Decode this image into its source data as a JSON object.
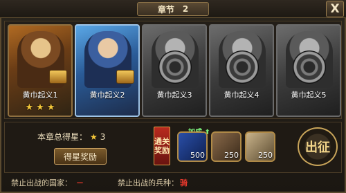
{
  "header": {
    "chapter_label": "章节",
    "chapter_number": "2",
    "close_label": "X"
  },
  "stages": [
    {
      "name": "黄巾起义1",
      "stars": 3,
      "locked": false
    },
    {
      "name": "黄巾起义2",
      "stars": 0,
      "locked": false
    },
    {
      "name": "黄巾起义3",
      "stars": 0,
      "locked": true
    },
    {
      "name": "黄巾起义4",
      "stars": 0,
      "locked": true
    },
    {
      "name": "黄巾起义5",
      "stars": 0,
      "locked": true
    }
  ],
  "summary": {
    "total_stars_label": "本章总得星：",
    "total_stars_value": "3",
    "star_reward_button": "得星奖励"
  },
  "pass_reward": {
    "label_line1": "通关",
    "label_line2": "奖励",
    "bonus_label": "加成",
    "items": [
      {
        "icon": "scroll-icon",
        "count": "500"
      },
      {
        "icon": "wood-bundle-icon",
        "count": "250"
      },
      {
        "icon": "coin-bag-icon",
        "count": "250"
      }
    ]
  },
  "march_button": "出征",
  "footer": {
    "banned_country_label": "禁止出战的国家：",
    "banned_country_value": "－",
    "banned_unit_label": "禁止出战的兵种：",
    "banned_unit_value": "骑"
  },
  "colors": {
    "accent_gold": "#caa161",
    "star": "#f5c83a",
    "warning_red": "#e4382c"
  }
}
